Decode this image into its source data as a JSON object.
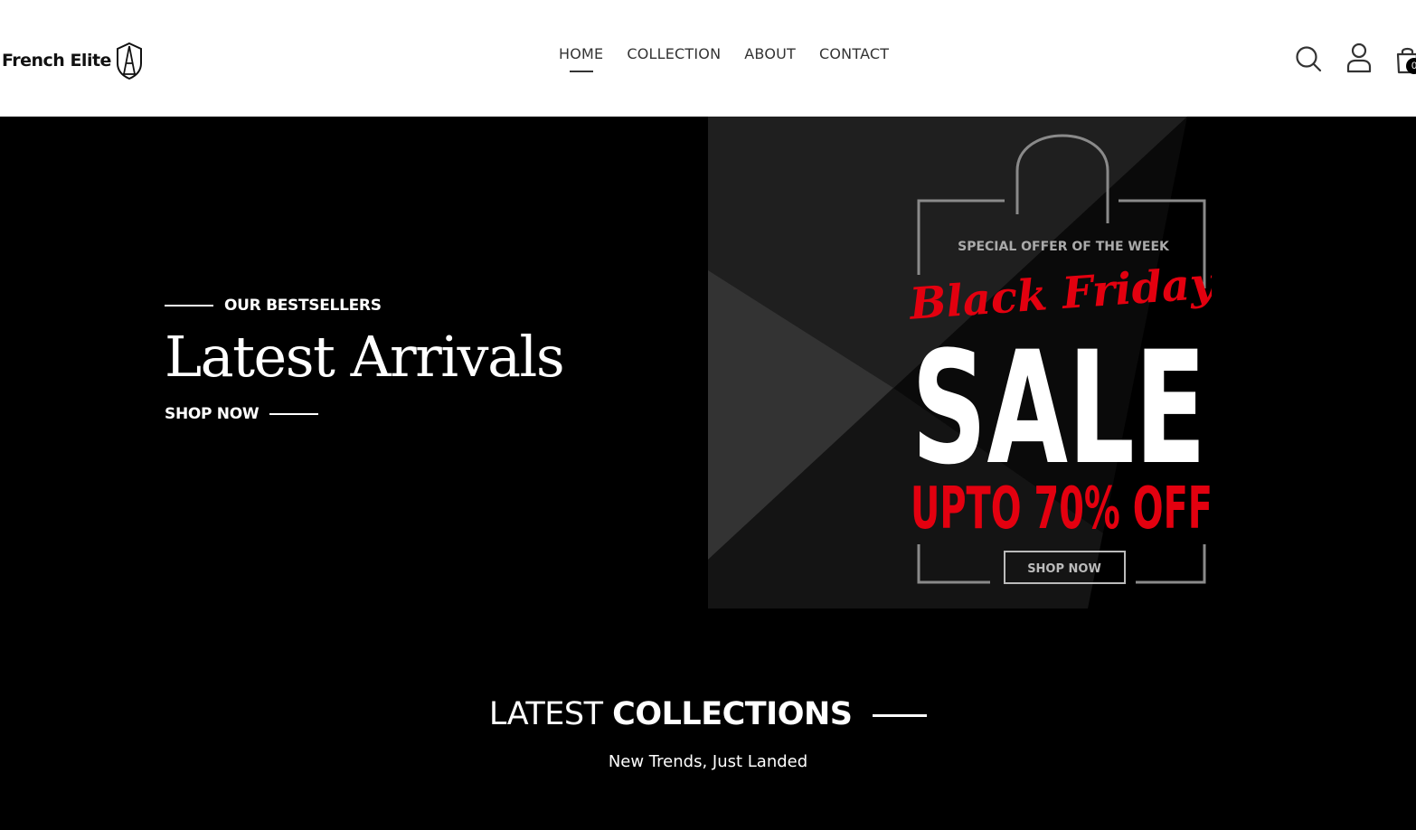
{
  "brand": {
    "name": "French Elite"
  },
  "nav": {
    "items": [
      {
        "label": "HOME",
        "active": true
      },
      {
        "label": "COLLECTION",
        "active": false
      },
      {
        "label": "ABOUT",
        "active": false
      },
      {
        "label": "CONTACT",
        "active": false
      }
    ]
  },
  "header_icons": [
    "search-icon",
    "user-icon",
    "cart-icon"
  ],
  "cart": {
    "count": "0"
  },
  "hero": {
    "eyebrow": "OUR BESTSELLERS",
    "title": "Latest Arrivals",
    "cta": "SHOP NOW"
  },
  "promo": {
    "eyebrow": "SPECIAL OFFER OF THE WEEK",
    "script_title": "Black Friday",
    "headline": "SALE",
    "discount": "UPTO 70% OFF",
    "button": "SHOP NOW"
  },
  "collections": {
    "title_light": "LATEST",
    "title_bold": "COLLECTIONS",
    "subtitle": "New Trends, Just Landed"
  },
  "colors": {
    "accent_red": "#e3000f",
    "dark": "#000000",
    "header_bg": "#ffffff"
  }
}
